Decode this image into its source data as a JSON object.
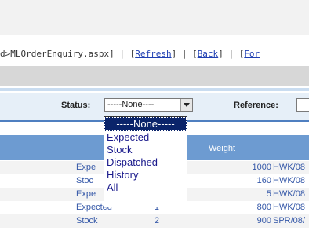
{
  "linkbar": {
    "path_text": "d>MLOrderEnquiry.aspx]",
    "refresh": "Refresh",
    "back": "Back",
    "forward_partial": "For"
  },
  "filters": {
    "status_label": "Status:",
    "status_value": "-----None----",
    "reference_label": "Reference:"
  },
  "table": {
    "weight_header": "Weight",
    "rows": [
      {
        "status": "Expe",
        "qty": "",
        "weight": "1000",
        "ref": "HWK/08"
      },
      {
        "status": "Stoc",
        "qty": "",
        "weight": "160",
        "ref": "HWK/08"
      },
      {
        "status": "Expe",
        "qty": "",
        "weight": "5",
        "ref": "HWK/08"
      },
      {
        "status": "Expected",
        "qty": "1",
        "weight": "800",
        "ref": "HWK/08"
      },
      {
        "status": "Stock",
        "qty": "2",
        "weight": "900",
        "ref": "SPR/08/"
      }
    ]
  },
  "dropdown": {
    "options": [
      "-----None-----",
      "Expected",
      "Stock",
      "Dispatched",
      "History",
      "All"
    ]
  }
}
